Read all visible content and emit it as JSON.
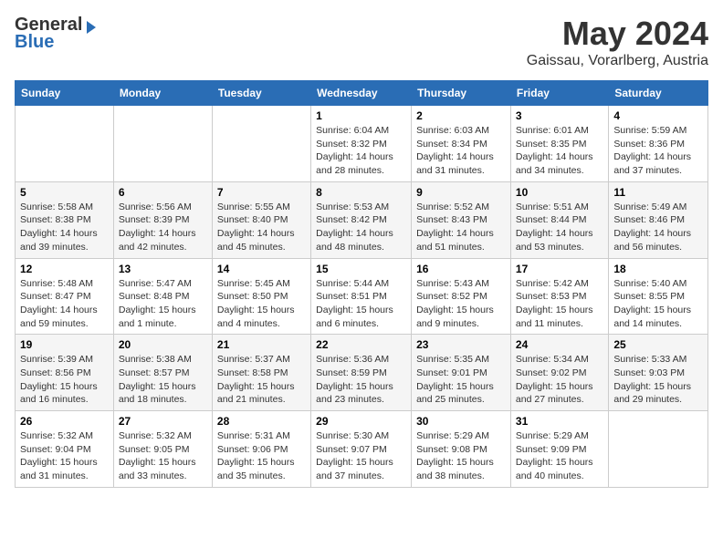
{
  "logo": {
    "general": "General",
    "blue": "Blue"
  },
  "header": {
    "month": "May 2024",
    "location": "Gaissau, Vorarlberg, Austria"
  },
  "days_of_week": [
    "Sunday",
    "Monday",
    "Tuesday",
    "Wednesday",
    "Thursday",
    "Friday",
    "Saturday"
  ],
  "weeks": [
    [
      {
        "day": "",
        "sunrise": "",
        "sunset": "",
        "daylight": ""
      },
      {
        "day": "",
        "sunrise": "",
        "sunset": "",
        "daylight": ""
      },
      {
        "day": "",
        "sunrise": "",
        "sunset": "",
        "daylight": ""
      },
      {
        "day": "1",
        "sunrise": "Sunrise: 6:04 AM",
        "sunset": "Sunset: 8:32 PM",
        "daylight": "Daylight: 14 hours and 28 minutes."
      },
      {
        "day": "2",
        "sunrise": "Sunrise: 6:03 AM",
        "sunset": "Sunset: 8:34 PM",
        "daylight": "Daylight: 14 hours and 31 minutes."
      },
      {
        "day": "3",
        "sunrise": "Sunrise: 6:01 AM",
        "sunset": "Sunset: 8:35 PM",
        "daylight": "Daylight: 14 hours and 34 minutes."
      },
      {
        "day": "4",
        "sunrise": "Sunrise: 5:59 AM",
        "sunset": "Sunset: 8:36 PM",
        "daylight": "Daylight: 14 hours and 37 minutes."
      }
    ],
    [
      {
        "day": "5",
        "sunrise": "Sunrise: 5:58 AM",
        "sunset": "Sunset: 8:38 PM",
        "daylight": "Daylight: 14 hours and 39 minutes."
      },
      {
        "day": "6",
        "sunrise": "Sunrise: 5:56 AM",
        "sunset": "Sunset: 8:39 PM",
        "daylight": "Daylight: 14 hours and 42 minutes."
      },
      {
        "day": "7",
        "sunrise": "Sunrise: 5:55 AM",
        "sunset": "Sunset: 8:40 PM",
        "daylight": "Daylight: 14 hours and 45 minutes."
      },
      {
        "day": "8",
        "sunrise": "Sunrise: 5:53 AM",
        "sunset": "Sunset: 8:42 PM",
        "daylight": "Daylight: 14 hours and 48 minutes."
      },
      {
        "day": "9",
        "sunrise": "Sunrise: 5:52 AM",
        "sunset": "Sunset: 8:43 PM",
        "daylight": "Daylight: 14 hours and 51 minutes."
      },
      {
        "day": "10",
        "sunrise": "Sunrise: 5:51 AM",
        "sunset": "Sunset: 8:44 PM",
        "daylight": "Daylight: 14 hours and 53 minutes."
      },
      {
        "day": "11",
        "sunrise": "Sunrise: 5:49 AM",
        "sunset": "Sunset: 8:46 PM",
        "daylight": "Daylight: 14 hours and 56 minutes."
      }
    ],
    [
      {
        "day": "12",
        "sunrise": "Sunrise: 5:48 AM",
        "sunset": "Sunset: 8:47 PM",
        "daylight": "Daylight: 14 hours and 59 minutes."
      },
      {
        "day": "13",
        "sunrise": "Sunrise: 5:47 AM",
        "sunset": "Sunset: 8:48 PM",
        "daylight": "Daylight: 15 hours and 1 minute."
      },
      {
        "day": "14",
        "sunrise": "Sunrise: 5:45 AM",
        "sunset": "Sunset: 8:50 PM",
        "daylight": "Daylight: 15 hours and 4 minutes."
      },
      {
        "day": "15",
        "sunrise": "Sunrise: 5:44 AM",
        "sunset": "Sunset: 8:51 PM",
        "daylight": "Daylight: 15 hours and 6 minutes."
      },
      {
        "day": "16",
        "sunrise": "Sunrise: 5:43 AM",
        "sunset": "Sunset: 8:52 PM",
        "daylight": "Daylight: 15 hours and 9 minutes."
      },
      {
        "day": "17",
        "sunrise": "Sunrise: 5:42 AM",
        "sunset": "Sunset: 8:53 PM",
        "daylight": "Daylight: 15 hours and 11 minutes."
      },
      {
        "day": "18",
        "sunrise": "Sunrise: 5:40 AM",
        "sunset": "Sunset: 8:55 PM",
        "daylight": "Daylight: 15 hours and 14 minutes."
      }
    ],
    [
      {
        "day": "19",
        "sunrise": "Sunrise: 5:39 AM",
        "sunset": "Sunset: 8:56 PM",
        "daylight": "Daylight: 15 hours and 16 minutes."
      },
      {
        "day": "20",
        "sunrise": "Sunrise: 5:38 AM",
        "sunset": "Sunset: 8:57 PM",
        "daylight": "Daylight: 15 hours and 18 minutes."
      },
      {
        "day": "21",
        "sunrise": "Sunrise: 5:37 AM",
        "sunset": "Sunset: 8:58 PM",
        "daylight": "Daylight: 15 hours and 21 minutes."
      },
      {
        "day": "22",
        "sunrise": "Sunrise: 5:36 AM",
        "sunset": "Sunset: 8:59 PM",
        "daylight": "Daylight: 15 hours and 23 minutes."
      },
      {
        "day": "23",
        "sunrise": "Sunrise: 5:35 AM",
        "sunset": "Sunset: 9:01 PM",
        "daylight": "Daylight: 15 hours and 25 minutes."
      },
      {
        "day": "24",
        "sunrise": "Sunrise: 5:34 AM",
        "sunset": "Sunset: 9:02 PM",
        "daylight": "Daylight: 15 hours and 27 minutes."
      },
      {
        "day": "25",
        "sunrise": "Sunrise: 5:33 AM",
        "sunset": "Sunset: 9:03 PM",
        "daylight": "Daylight: 15 hours and 29 minutes."
      }
    ],
    [
      {
        "day": "26",
        "sunrise": "Sunrise: 5:32 AM",
        "sunset": "Sunset: 9:04 PM",
        "daylight": "Daylight: 15 hours and 31 minutes."
      },
      {
        "day": "27",
        "sunrise": "Sunrise: 5:32 AM",
        "sunset": "Sunset: 9:05 PM",
        "daylight": "Daylight: 15 hours and 33 minutes."
      },
      {
        "day": "28",
        "sunrise": "Sunrise: 5:31 AM",
        "sunset": "Sunset: 9:06 PM",
        "daylight": "Daylight: 15 hours and 35 minutes."
      },
      {
        "day": "29",
        "sunrise": "Sunrise: 5:30 AM",
        "sunset": "Sunset: 9:07 PM",
        "daylight": "Daylight: 15 hours and 37 minutes."
      },
      {
        "day": "30",
        "sunrise": "Sunrise: 5:29 AM",
        "sunset": "Sunset: 9:08 PM",
        "daylight": "Daylight: 15 hours and 38 minutes."
      },
      {
        "day": "31",
        "sunrise": "Sunrise: 5:29 AM",
        "sunset": "Sunset: 9:09 PM",
        "daylight": "Daylight: 15 hours and 40 minutes."
      },
      {
        "day": "",
        "sunrise": "",
        "sunset": "",
        "daylight": ""
      }
    ]
  ]
}
